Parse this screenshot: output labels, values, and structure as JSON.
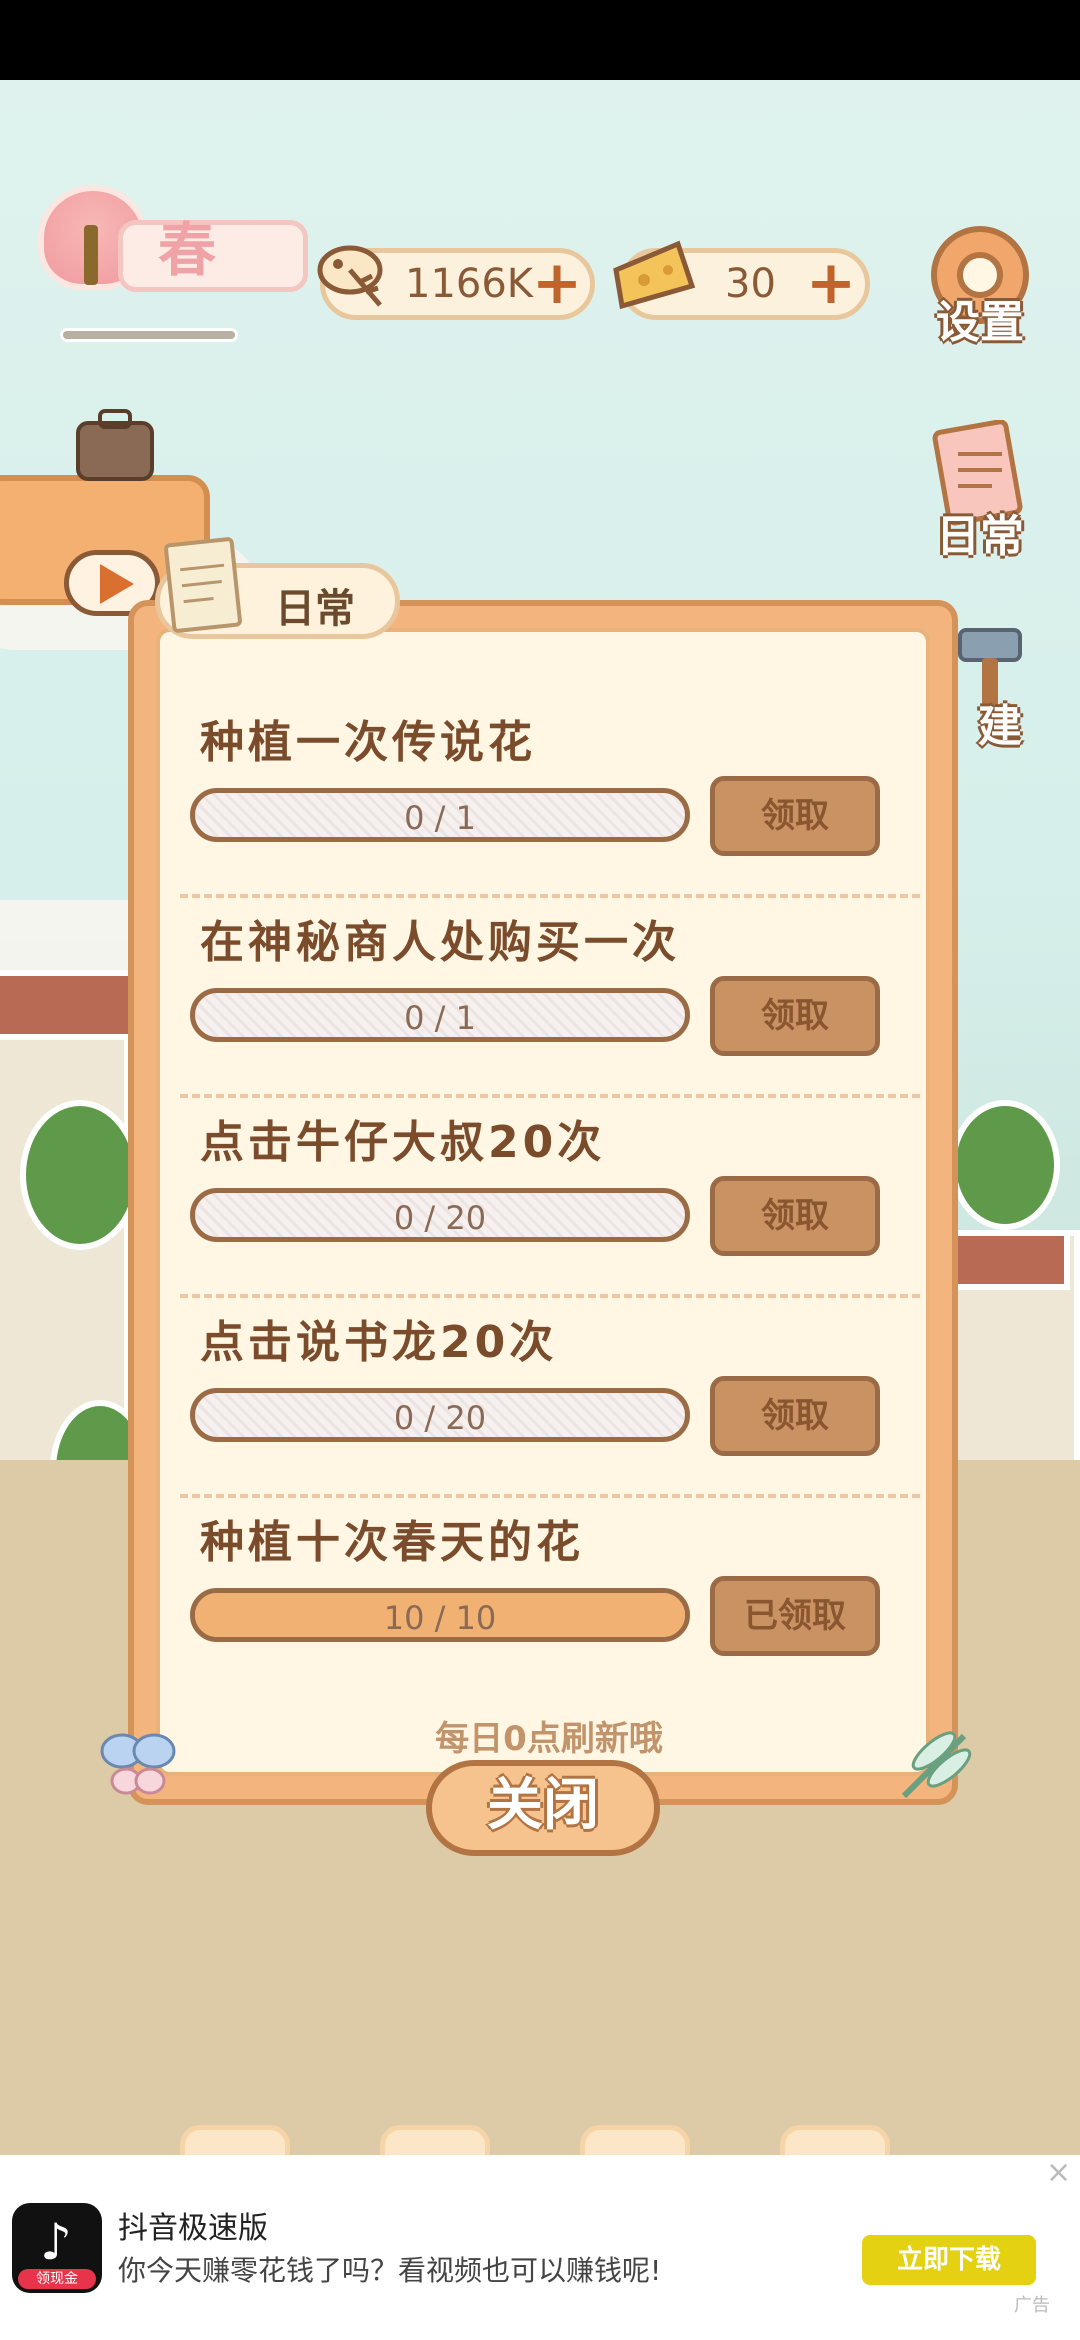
{
  "hud": {
    "season_label": "春",
    "season_progress": 1.0,
    "fish_amount": "1166K",
    "cheese_amount": "30",
    "settings_label": "设置",
    "daily_label": "日常",
    "build_label": "建"
  },
  "dialog": {
    "tab_title": "日常",
    "tasks": [
      {
        "title": "种植一次传说花",
        "progress_text": "0 / 1",
        "progress": 0.0,
        "button": "领取"
      },
      {
        "title": "在神秘商人处购买一次",
        "progress_text": "0 / 1",
        "progress": 0.0,
        "button": "领取"
      },
      {
        "title": "点击牛仔大叔20次",
        "progress_text": "0 / 20",
        "progress": 0.0,
        "button": "领取"
      },
      {
        "title": "点击说书龙20次",
        "progress_text": "0 / 20",
        "progress": 0.0,
        "button": "领取"
      },
      {
        "title": "种植十次春天的花",
        "progress_text": "10 / 10",
        "progress": 1.0,
        "button": "已领取"
      }
    ],
    "refresh_note": "每日0点刷新哦",
    "close_label": "关闭"
  },
  "ad": {
    "logo_tag": "领现金",
    "title": "抖音极速版",
    "text": "你今天赚零花钱了吗？看视频也可以赚钱呢!",
    "cta": "立即下载",
    "close": "×",
    "mark": "广告"
  },
  "colors": {
    "accent": "#c0642b",
    "panel": "#fff6e4",
    "frame": "#f3b57d",
    "ad_cta": "#e3d112"
  }
}
